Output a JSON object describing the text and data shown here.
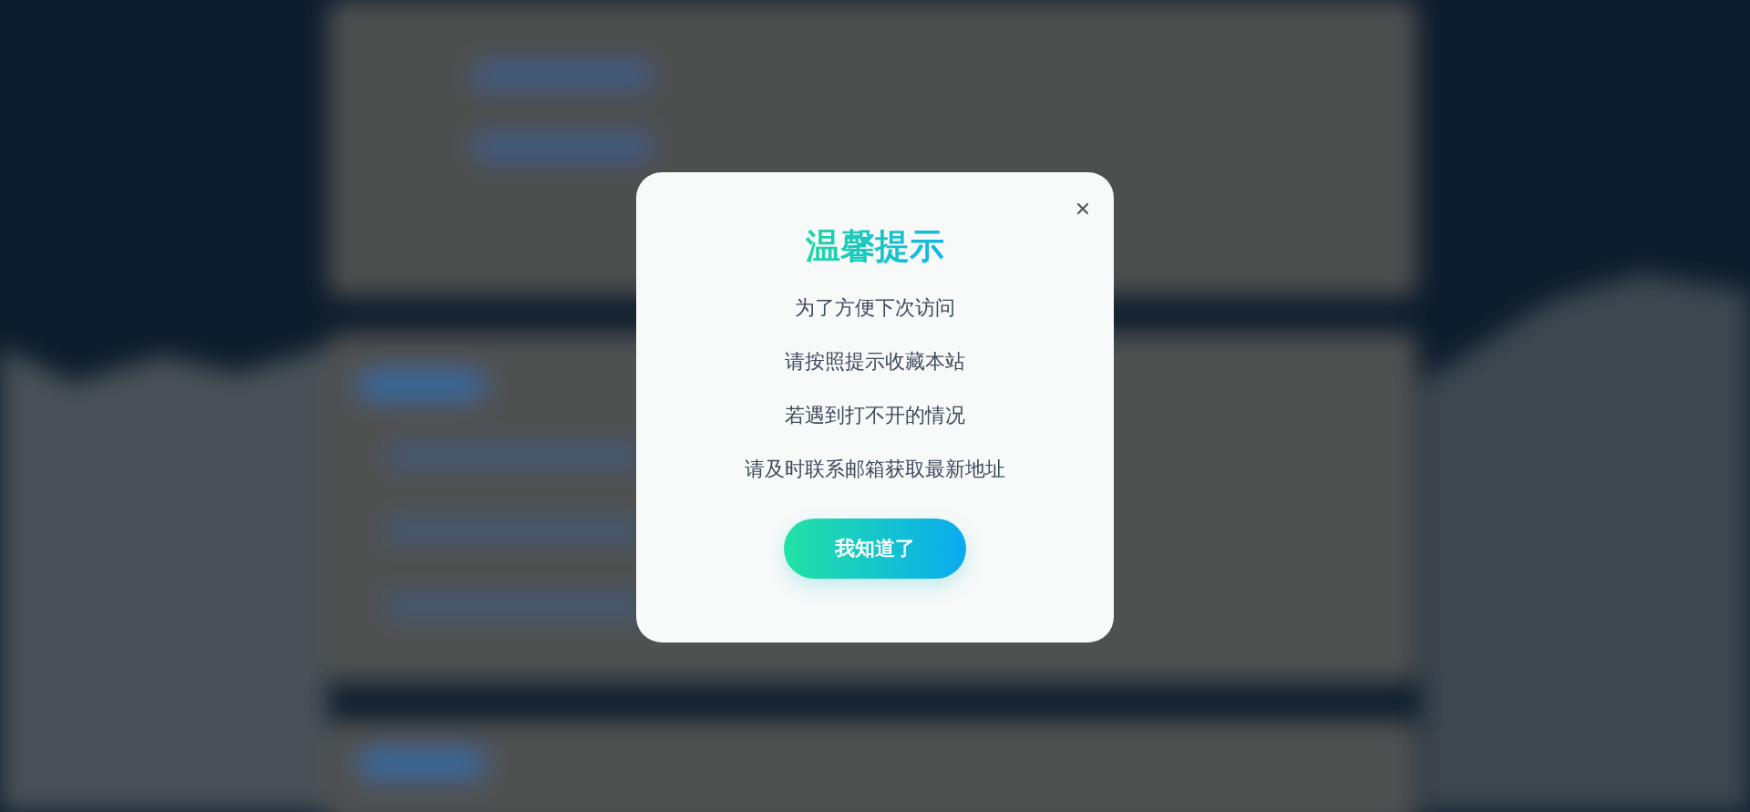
{
  "dialog": {
    "title": "温馨提示",
    "lines": [
      "为了方便下次访问",
      "请按照提示收藏本站",
      "若遇到打不开的情况",
      "请及时联系邮箱获取最新地址"
    ],
    "button": "我知道了"
  }
}
